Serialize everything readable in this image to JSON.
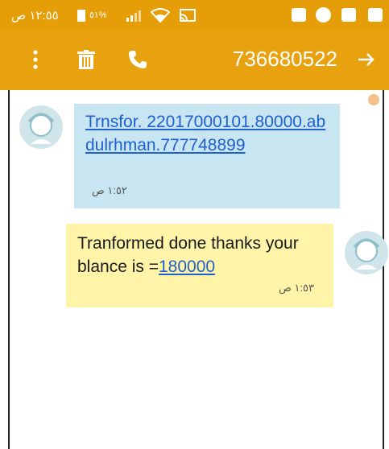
{
  "status_bar": {
    "time": "١٢:٥٥ ص",
    "battery_percent": "%٥١",
    "icons": [
      "battery-icon",
      "signal-icon",
      "wifi-icon",
      "cast-icon",
      "vpn-key-icon",
      "messenger-icon",
      "mail-icon",
      "video-icon"
    ]
  },
  "toolbar": {
    "number": "736680522",
    "icons": [
      "more-vert-icon",
      "trash-icon",
      "phone-icon",
      "forward-arrow-icon"
    ]
  },
  "messages": [
    {
      "direction": "incoming",
      "text": "Trnsfor. 22017000101.80000.abdulrhman.777748899",
      "time": "١:٥٢ ص"
    },
    {
      "direction": "outgoing",
      "text_prefix": "Tranformed done thanks your blance is =",
      "text_link": "180000",
      "time": "١:٥٣ ص"
    }
  ],
  "colors": {
    "status_bar": "#e59e08",
    "toolbar": "#e8a20f",
    "incoming_bubble": "#c8e6f2",
    "outgoing_bubble": "#fff4a8",
    "link": "#1f5fcf"
  }
}
